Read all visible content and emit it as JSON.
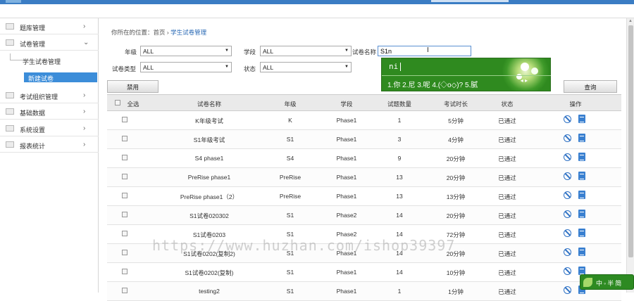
{
  "sidebar": {
    "items": [
      {
        "label": "题库管理",
        "has_chevron": true
      },
      {
        "label": "试卷管理",
        "has_chevron": true
      },
      {
        "label": "考试组织管理",
        "has_chevron": true
      },
      {
        "label": "基础数据",
        "has_chevron": true
      },
      {
        "label": "系统设置",
        "has_chevron": true
      },
      {
        "label": "报表统计",
        "has_chevron": true
      }
    ],
    "subitems": [
      {
        "label": "学生试卷管理"
      },
      {
        "label": "新建试卷",
        "active": true
      }
    ]
  },
  "breadcrumb": {
    "prefix": "你所在的位置：首页 ›",
    "current": "学生试卷管理"
  },
  "filters": {
    "grade_label": "年级",
    "grade_value": "ALL",
    "phase_label": "学段",
    "phase_value": "ALL",
    "name_label": "试卷名称",
    "name_value": "S1n",
    "type_label": "试卷类型",
    "type_value": "ALL",
    "status_label": "状态",
    "status_value": "ALL"
  },
  "buttons": {
    "disable": "禁用",
    "query": "查询"
  },
  "table": {
    "headers": {
      "select_all": "全选",
      "name": "试卷名称",
      "grade": "年级",
      "phase": "学段",
      "count": "试题数量",
      "duration": "考试时长",
      "status": "状态",
      "ops": "操作"
    },
    "rows": [
      {
        "name": "K年级考试",
        "grade": "K",
        "phase": "Phase1",
        "count": "1",
        "duration": "5分钟",
        "status": "已通过"
      },
      {
        "name": "S1年级考试",
        "grade": "S1",
        "phase": "Phase1",
        "count": "3",
        "duration": "4分钟",
        "status": "已通过"
      },
      {
        "name": "S4 phase1",
        "grade": "S4",
        "phase": "Phase1",
        "count": "9",
        "duration": "20分钟",
        "status": "已通过"
      },
      {
        "name": "PreRise phase1",
        "grade": "PreRise",
        "phase": "Phase1",
        "count": "13",
        "duration": "20分钟",
        "status": "已通过"
      },
      {
        "name": "PreRise phase1（2）",
        "grade": "PreRise",
        "phase": "Phase1",
        "count": "13",
        "duration": "13分钟",
        "status": "已通过"
      },
      {
        "name": "S1试卷020302",
        "grade": "S1",
        "phase": "Phase2",
        "count": "14",
        "duration": "20分钟",
        "status": "已通过"
      },
      {
        "name": "S1试卷0203",
        "grade": "S1",
        "phase": "Phase2",
        "count": "14",
        "duration": "72分钟",
        "status": "已通过"
      },
      {
        "name": "S1试卷0202(复制2)",
        "grade": "S1",
        "phase": "Phase1",
        "count": "14",
        "duration": "20分钟",
        "status": "已通过"
      },
      {
        "name": "S1试卷0202(复制)",
        "grade": "S1",
        "phase": "Phase1",
        "count": "14",
        "duration": "10分钟",
        "status": "已通过"
      },
      {
        "name": "testing2",
        "grade": "S1",
        "phase": "Phase1",
        "count": "1",
        "duration": "1分钟",
        "status": "已通过"
      }
    ]
  },
  "ime": {
    "pinyin": "ni",
    "candidates": "1.你 2.尼 3.呢 4.(◇o◇)? 5.腻",
    "bar_text": "中◦半简"
  },
  "watermark": "https://www.huzhan.com/ishop39397",
  "colors": {
    "accent": "#3c8dd9",
    "ime_green": "#2f8a1f",
    "action_blue": "#2f72c5"
  }
}
